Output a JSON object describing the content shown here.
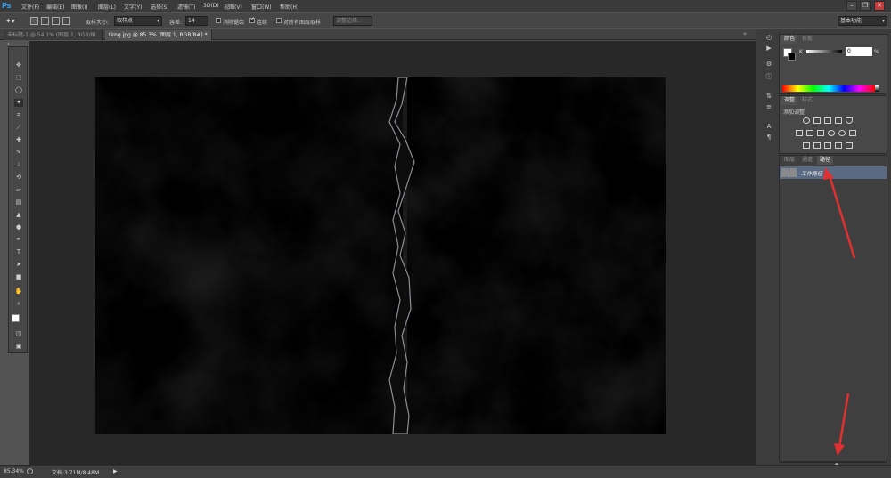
{
  "app": {
    "logo": "Ps"
  },
  "menubar": {
    "items": [
      "文件(F)",
      "编辑(E)",
      "图像(I)",
      "图层(L)",
      "文字(Y)",
      "选择(S)",
      "滤镜(T)",
      "3D(D)",
      "视图(V)",
      "窗口(W)",
      "帮助(H)"
    ],
    "window_controls": {
      "minimize": "–",
      "restore": "❐",
      "close": "✕"
    }
  },
  "optionsbar": {
    "sample_size_label": "取样大小:",
    "sample_size_value": "取样点",
    "tolerance_label": "容差:",
    "tolerance_value": "14",
    "antialias_label": "消除锯齿",
    "contiguous_label": "连续",
    "all_layers_label": "对所有图层取样",
    "refine_edge_label": "调整边缘...",
    "workspace_value": "基本功能"
  },
  "tabs": [
    {
      "label": "未标题-1 @ 54.1% (图层 1, RGB/8) *",
      "active": false
    },
    {
      "label": "timg.jpg @ 85.3% (图层 1, RGB/8#) *",
      "active": true
    }
  ],
  "statusbar": {
    "zoom": "85.34%",
    "doc_info": "文档:3.71M/8.48M"
  },
  "panels": {
    "color": {
      "tabs": [
        "颜色",
        "色板"
      ],
      "k_label": "K",
      "k_value": "0",
      "unit": "%"
    },
    "adjustments": {
      "tabs": [
        "调整",
        "样式"
      ],
      "title": "添加调整"
    },
    "paths": {
      "tabs": [
        "图层",
        "通道",
        "路径"
      ],
      "active_tab": "路径",
      "work_path_label": "工作路径"
    }
  },
  "colors": {
    "accent": "#e03030",
    "selection": "#5a6a82"
  }
}
